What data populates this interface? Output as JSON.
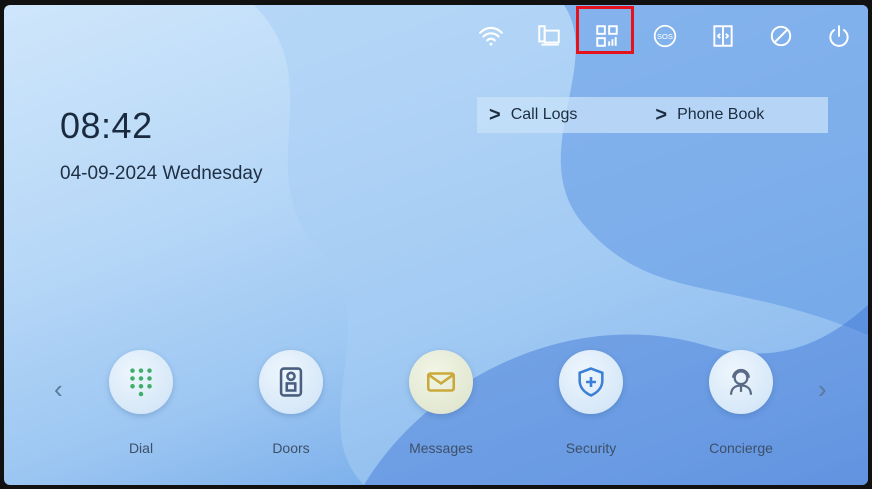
{
  "clock": {
    "time": "08:42",
    "date": "04-09-2024 Wednesday"
  },
  "status_bar": {
    "icons": [
      {
        "name": "wifi-icon"
      },
      {
        "name": "monitor-icon"
      },
      {
        "name": "qr-code-icon"
      },
      {
        "name": "sos-icon",
        "label": "SOS"
      },
      {
        "name": "door-unlock-icon"
      },
      {
        "name": "do-not-disturb-icon"
      },
      {
        "name": "power-icon"
      }
    ]
  },
  "quick_links": {
    "call_logs": "Call Logs",
    "phone_book": "Phone Book"
  },
  "dock": {
    "prev_arrow": "‹",
    "next_arrow": "›",
    "apps": [
      {
        "name": "dial",
        "label": "Dial",
        "icon": "keypad-icon",
        "color": "#3fae6a"
      },
      {
        "name": "doors",
        "label": "Doors",
        "icon": "door-station-icon",
        "color": "#4a5f80"
      },
      {
        "name": "messages",
        "label": "Messages",
        "icon": "envelope-icon",
        "color": "#c9a93a"
      },
      {
        "name": "security",
        "label": "Security",
        "icon": "shield-plus-icon",
        "color": "#3c7fd6"
      },
      {
        "name": "concierge",
        "label": "Concierge",
        "icon": "headset-person-icon",
        "color": "#5a6a86"
      }
    ]
  },
  "colors": {
    "highlight": "#e3121b",
    "text_dark": "#1a2b40"
  }
}
